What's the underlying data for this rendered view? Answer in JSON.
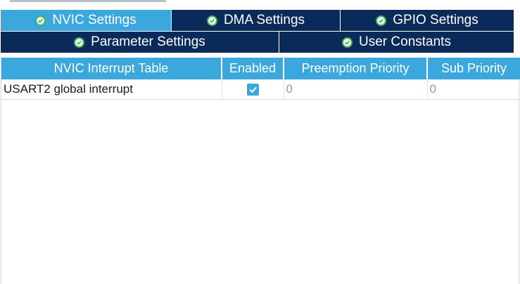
{
  "tabs_row1": [
    {
      "label": "NVIC Settings",
      "active": true
    },
    {
      "label": "DMA Settings",
      "active": false
    },
    {
      "label": "GPIO Settings",
      "active": false
    }
  ],
  "tabs_row2": [
    {
      "label": "Parameter Settings",
      "active": false
    },
    {
      "label": "User Constants",
      "active": false
    }
  ],
  "table": {
    "headers": [
      "NVIC Interrupt Table",
      "Enabled",
      "Preemption Priority",
      "Sub Priority"
    ],
    "rows": [
      {
        "name": "USART2 global interrupt",
        "enabled": true,
        "preemption": "0",
        "sub": "0"
      }
    ]
  },
  "colors": {
    "tab_active": "#3aa8dc",
    "tab_inactive": "#0a2b59",
    "header_bg": "#3aa8dc",
    "status_icon": "#42b05a"
  },
  "icons": {
    "tab_status": "check-circle-icon",
    "enabled": "checkbox-checked-icon"
  }
}
